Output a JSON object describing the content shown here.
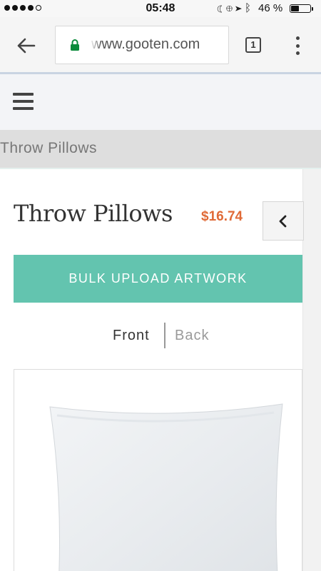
{
  "status_bar": {
    "time": "05:48",
    "battery_percent": "46 %",
    "battery_level": 0.46,
    "signal_dots_filled": 4,
    "icons": [
      "moon-icon",
      "orientation-lock-icon",
      "location-arrow-icon",
      "bluetooth-icon"
    ]
  },
  "browser": {
    "url": "www.gooten.com",
    "tab_count": "1"
  },
  "breadcrumb": "Throw Pillows",
  "product": {
    "title": "Throw Pillows",
    "price": "$16.74",
    "bulk_upload_label": "BULK UPLOAD ARTWORK",
    "sides": {
      "front": "Front",
      "back": "Back",
      "selected": "Front"
    }
  },
  "colors": {
    "accent": "#63c4af",
    "price": "#e06a37",
    "header_bg": "#f3f4f7",
    "breadcrumb_bg": "#dedede"
  }
}
